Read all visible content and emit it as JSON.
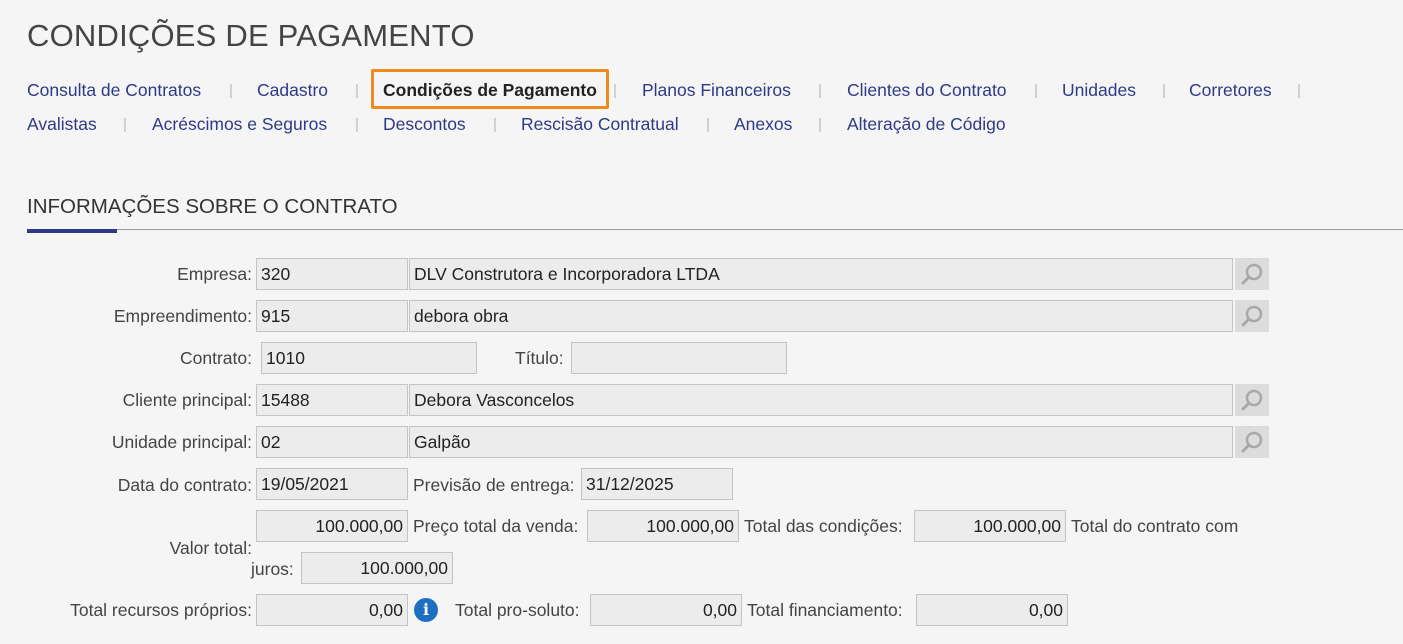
{
  "page": {
    "title": "CONDIÇÕES DE PAGAMENTO"
  },
  "nav": {
    "row1": [
      "Consulta de Contratos",
      "Cadastro",
      "Condições de Pagamento",
      "Planos Financeiros",
      "Clientes do Contrato",
      "Unidades",
      "Corretores"
    ],
    "row2": [
      "Avalistas",
      "Acréscimos e Seguros",
      "Descontos",
      "Rescisão Contratual",
      "Anexos",
      "Alteração de Código"
    ],
    "separator": "|",
    "active": "Condições de Pagamento"
  },
  "section": {
    "title": "INFORMAÇÕES SOBRE O CONTRATO"
  },
  "form": {
    "empresa": {
      "label": "Empresa:",
      "code": "320",
      "name": "DLV Construtora e Incorporadora LTDA"
    },
    "empreendimento": {
      "label": "Empreendimento:",
      "code": "915",
      "name": "debora obra"
    },
    "contrato": {
      "label": "Contrato:",
      "value": "1010"
    },
    "titulo": {
      "label": "Título:",
      "value": ""
    },
    "cliente": {
      "label": "Cliente principal:",
      "code": "15488",
      "name": "Debora Vasconcelos"
    },
    "unidade": {
      "label": "Unidade principal:",
      "code": "02",
      "name": "Galpão"
    },
    "data_contrato": {
      "label": "Data do contrato:",
      "value": "19/05/2021"
    },
    "previsao_entrega": {
      "label": "Previsão de entrega:",
      "value": "31/12/2025"
    },
    "valor_total": {
      "label": "Valor total:",
      "value": "100.000,00"
    },
    "preco_total_venda": {
      "label": "Preço total da venda:",
      "value": "100.000,00"
    },
    "total_condicoes": {
      "label": "Total das condições:",
      "value": "100.000,00"
    },
    "total_contrato_juros": {
      "label_line1": "Total do contrato com",
      "label_line2": "juros:",
      "value": "100.000,00"
    },
    "total_recursos_proprios": {
      "label": "Total recursos próprios:",
      "value": "0,00"
    },
    "total_pro_soluto": {
      "label": "Total pro-soluto:",
      "value": "0,00"
    },
    "total_financiamento": {
      "label": "Total financiamento:",
      "value": "0,00"
    }
  },
  "icons": {
    "lookup": "search-icon",
    "info": "info-icon"
  },
  "colors": {
    "nav_link": "#2e3a87",
    "active_border": "#f08a1c",
    "section_accent": "#2e3a87",
    "info_icon": "#1f6fc1"
  }
}
